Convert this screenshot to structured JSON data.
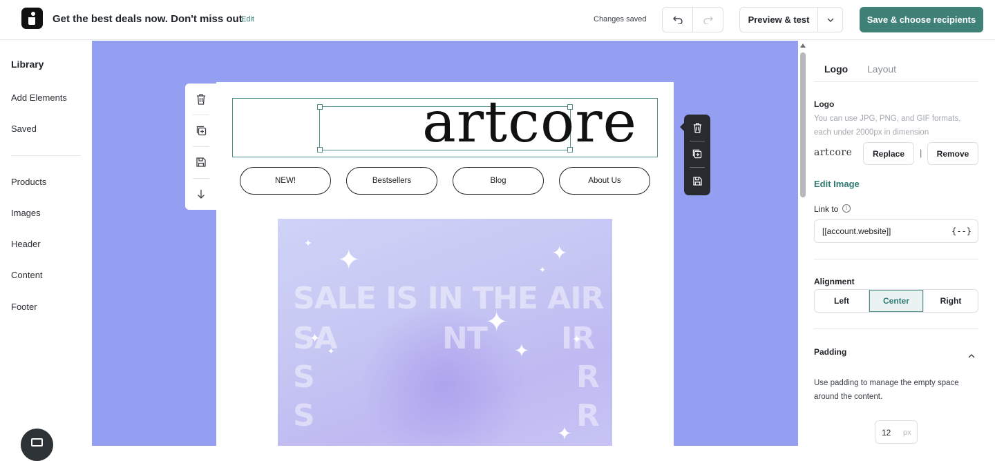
{
  "header": {
    "title": "Get the best deals now. Don't miss out",
    "edit_label": "Edit",
    "status": "Changes saved",
    "preview_label": "Preview & test",
    "save_label": "Save & choose recipients",
    "accent_color": "#3f8077"
  },
  "sidebar": {
    "title": "Library",
    "items": [
      "Add Elements",
      "Saved",
      "Products",
      "Images",
      "Header",
      "Content",
      "Footer"
    ]
  },
  "canvas": {
    "background_color": "#959ff1",
    "logo_text": "artcore",
    "nav_buttons": [
      "NEW!",
      "Bestsellers",
      "Blog",
      "About Us"
    ],
    "hero_text": "SALE IS IN THE AIR",
    "hero_repeat_fragments": [
      "SA",
      "NT",
      "IR",
      "S",
      "R",
      "S",
      "R"
    ]
  },
  "panel": {
    "tabs": [
      "Logo",
      "Layout"
    ],
    "active_tab": "Logo",
    "logo_label": "Logo",
    "logo_help": "You can use JPG, PNG, and GIF formats, each under 2000px in dimension",
    "logo_preview": "artcore",
    "replace_label": "Replace",
    "separator": "|",
    "remove_label": "Remove",
    "edit_image_label": "Edit Image",
    "link_label": "Link to",
    "link_value": "[[account.website]]",
    "link_var_icon": "{--}",
    "alignment_label": "Alignment",
    "alignment_options": [
      "Left",
      "Center",
      "Right"
    ],
    "alignment_selected": "Center",
    "padding_label": "Padding",
    "padding_help": "Use padding to manage the empty space around the content.",
    "padding_value": "12",
    "padding_unit": "px"
  }
}
